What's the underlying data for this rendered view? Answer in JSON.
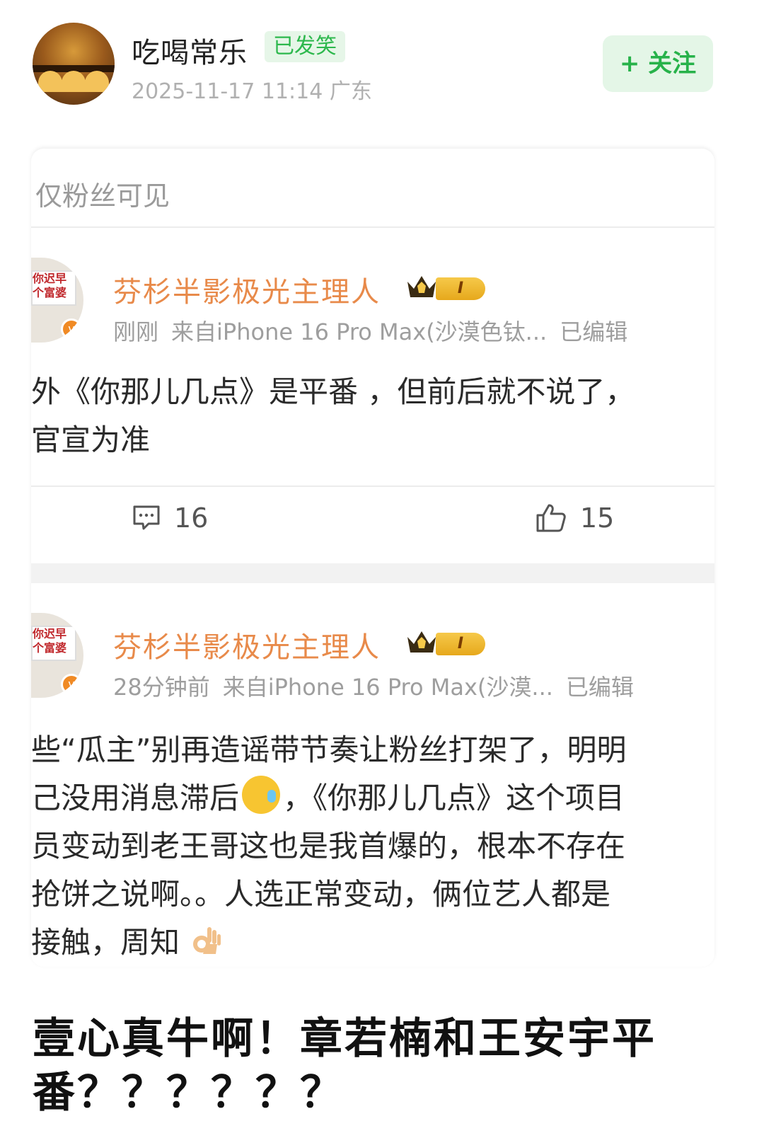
{
  "post": {
    "author": "吃喝常乐",
    "author_badge": "已发笑",
    "timestamp": "2025-11-17 11:14  广东",
    "follow_label": "+ 关注"
  },
  "card": {
    "visibility": "仅粉丝可见",
    "comments": [
      {
        "name": "芬杉半影极光主理人",
        "level": "I",
        "avatar_text": "你迟早\n个富婆",
        "time": "刚刚",
        "source": "来自iPhone 16 Pro Max(沙漠色钛...",
        "edited": "已编辑",
        "lines": [
          "外《你那儿几点》是平番 ，但前后就不说了，",
          "官宣为准"
        ],
        "comment_count": "16",
        "like_count": "15"
      },
      {
        "name": "芬杉半影极光主理人",
        "level": "I",
        "avatar_text": "你迟早\n个富婆",
        "time": "28分钟前",
        "source": "来自iPhone 16 Pro Max(沙漠...",
        "edited": "已编辑",
        "lines": [
          "些“瓜主”别再造谣带节奏让粉丝打架了，明明",
          "己没用消息滞后",
          "，《你那儿几点》这个项目",
          "员变动到老王哥这也是我首爆的，根本不存在",
          "抢饼之说啊。。人选正常变动，俩位艺人都是",
          "接触，周知"
        ]
      }
    ]
  },
  "headline": {
    "line1": "壹心真牛啊！章若楠和王安宇平",
    "line2": "番？？？？？？"
  },
  "colors": {
    "accent_green": "#2db84d",
    "name_orange": "#e88a4a",
    "crown_gold": "#e6a81c"
  },
  "icons": [
    "comment-icon",
    "like-icon",
    "crown-icon",
    "verified-icon",
    "sweat-emoji",
    "ok-hand-emoji"
  ]
}
